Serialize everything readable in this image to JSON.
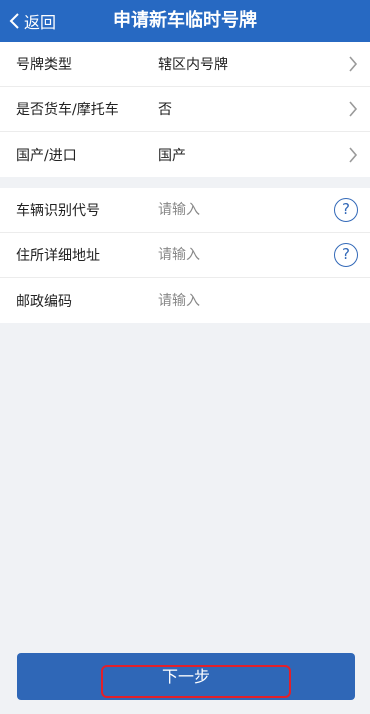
{
  "header": {
    "back_label": "返回",
    "title": "申请新车临时号牌"
  },
  "group1": [
    {
      "label": "号牌类型",
      "value": "辖区内号牌"
    },
    {
      "label": "是否货车/摩托车",
      "value": "否"
    },
    {
      "label": "国产/进口",
      "value": "国产"
    }
  ],
  "group2": [
    {
      "label": "车辆识别代号",
      "placeholder": "请输入",
      "help": "?"
    },
    {
      "label": "住所详细地址",
      "placeholder": "请输入",
      "help": "?"
    },
    {
      "label": "邮政编码",
      "placeholder": "请输入"
    }
  ],
  "footer": {
    "next_label": "下一步"
  },
  "colors": {
    "header_bg": "#2769c2",
    "button_bg": "#2f67b7",
    "help_icon": "#3369b8",
    "highlight": "#e2202a"
  }
}
